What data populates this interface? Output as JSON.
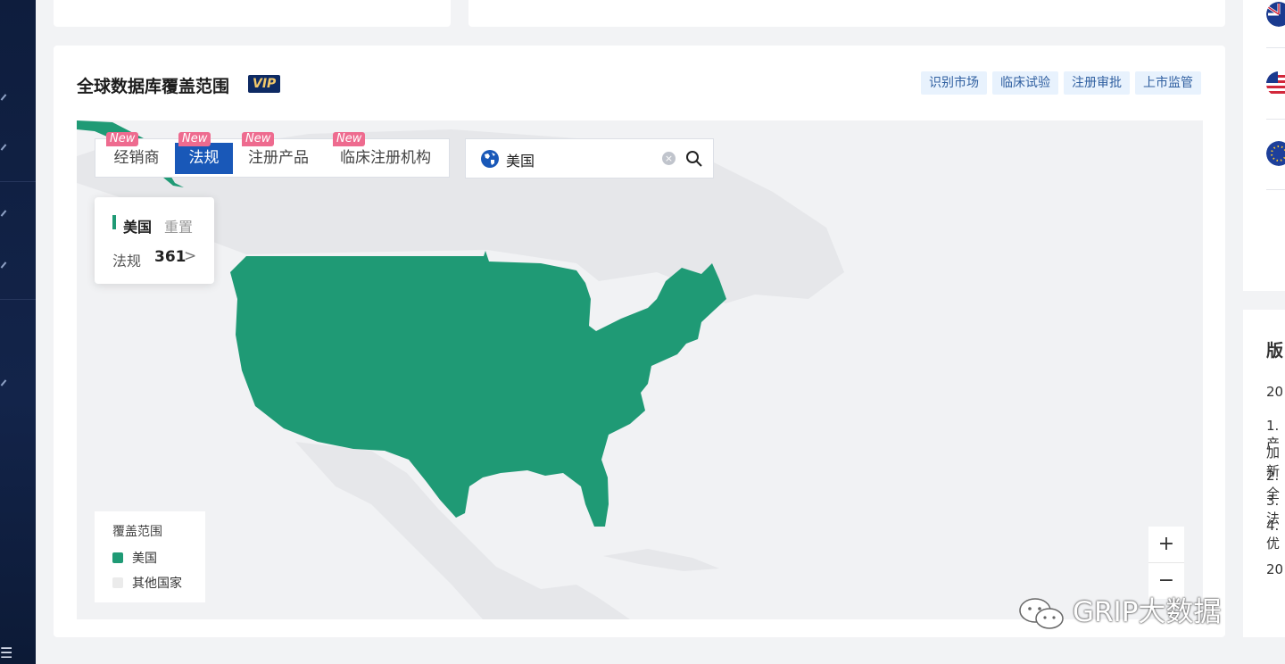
{
  "section": {
    "title": "全球数据库覆盖范围",
    "vip_badge": "VIP",
    "tags": [
      "识别市场",
      "临床试验",
      "注册审批",
      "上市监管"
    ]
  },
  "tabs": [
    {
      "label": "经销商",
      "badge": "New",
      "active": false
    },
    {
      "label": "法规",
      "badge": "New",
      "active": true
    },
    {
      "label": "注册产品",
      "badge": "New",
      "active": false
    },
    {
      "label": "临床注册机构",
      "badge": "New",
      "active": false
    }
  ],
  "search": {
    "value": "美国",
    "icon": "globe-icon"
  },
  "info": {
    "country": "美国",
    "reset": "重置",
    "metric_label": "法规",
    "metric_value": "361",
    "arrow": ">"
  },
  "legend": {
    "title": "覆盖范围",
    "items": [
      {
        "label": "美国",
        "color": "#1f9a75"
      },
      {
        "label": "其他国家",
        "color": "#ebebeb"
      }
    ]
  },
  "zoom": {
    "in": "+",
    "out": "−"
  },
  "right_panel": {
    "title": "版",
    "lines": [
      "20",
      "1.产",
      "加新",
      "2.全",
      "3.法",
      "4.优",
      "20"
    ]
  },
  "sidebar": {
    "menu_glyph": "☰"
  },
  "watermark": "GRIP大数据",
  "colors": {
    "accent": "#1958b8",
    "highlight": "#1f9a75",
    "new_badge": "#ee6b8f"
  }
}
